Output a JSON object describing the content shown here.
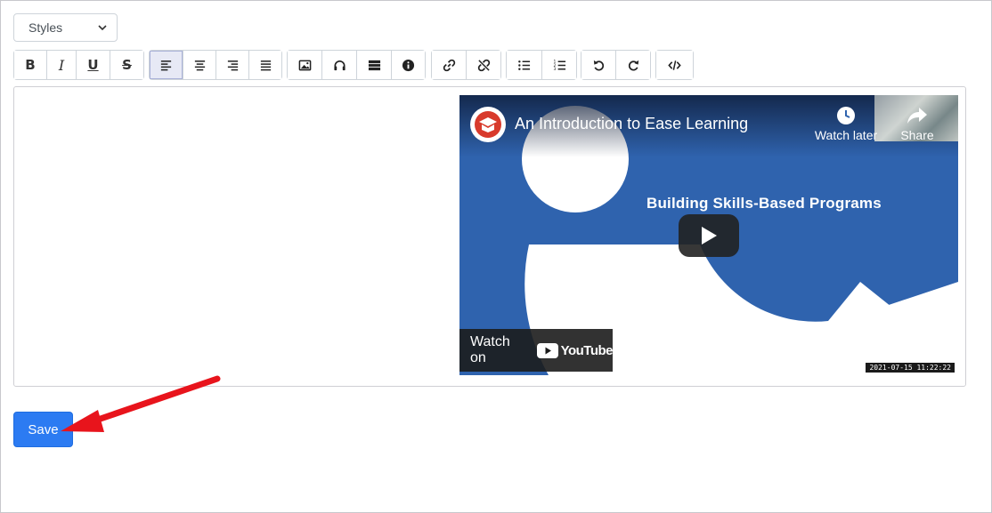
{
  "styles_select": {
    "selected": "Styles"
  },
  "toolbar": {
    "bold_label": "B",
    "italic_label": "I",
    "underline_label": "U",
    "strikethrough_label": "S",
    "groups": [
      [
        "bold-button",
        "italic-button",
        "underline-button",
        "strikethrough-button"
      ],
      [
        "align-left-button",
        "align-center-button",
        "align-right-button",
        "align-justify-button"
      ],
      [
        "insert-image-button",
        "insert-audio-button",
        "insert-media-button",
        "insert-info-button"
      ],
      [
        "insert-link-button",
        "remove-link-button"
      ],
      [
        "bullet-list-button",
        "numbered-list-button"
      ],
      [
        "undo-button",
        "redo-button"
      ],
      [
        "code-view-button"
      ]
    ],
    "active": "align-left-button"
  },
  "video": {
    "title": "An Introduction to Ease Learning",
    "watch_later": "Watch later",
    "share": "Share",
    "subtitle": "Building Skills-Based Programs",
    "watch_on": "Watch on",
    "youtube": "YouTube",
    "timestamp": "2021-07-15  11:22:22"
  },
  "save_label": "Save",
  "colors": {
    "accent": "#2c7bf2",
    "video_bg": "#2f63ae",
    "arrow": "#e8141c",
    "toolbar_active": "#e7e9f5"
  }
}
